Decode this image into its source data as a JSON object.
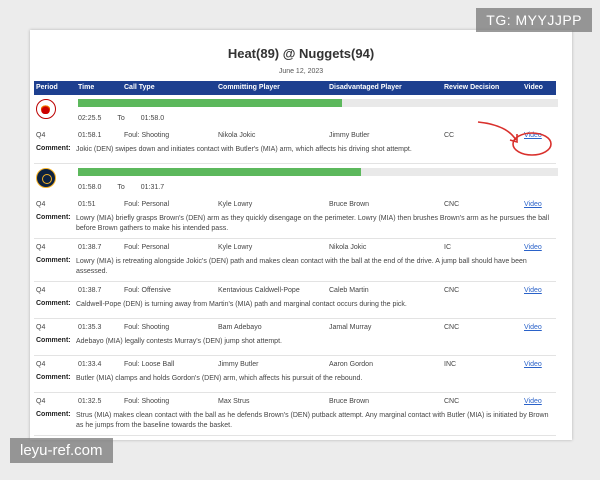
{
  "watermarks": {
    "top_right": "TG: MYYJJPP",
    "bottom_left": "leyu-ref.com"
  },
  "title": "Heat(89) @ Nuggets(94)",
  "date": "June 12, 2023",
  "columns": [
    "Period",
    "Time",
    "Call Type",
    "Committing Player",
    "Disadvantaged Player",
    "Review Decision",
    "Video"
  ],
  "to_label": "To",
  "comment_label": "Comment:",
  "blocks": [
    {
      "team": "heat",
      "team_icon": "miami-heat-logo",
      "bar_color": "#5cb85c",
      "progress": 0.55,
      "time_start": "02:25.5",
      "time_end": "01:58.0",
      "plays": [
        {
          "period": "Q4",
          "time": "01:58.1",
          "call_type": "Foul: Shooting",
          "committing": "Nikola Jokic",
          "disadvantaged": "Jimmy Butler",
          "decision": "CC",
          "video": "Video",
          "comment": "Jokic (DEN) swipes down and initiates contact with Butler's (MIA) arm, which affects his driving shot attempt."
        }
      ]
    },
    {
      "team": "nuggets",
      "team_icon": "denver-nuggets-logo",
      "bar_color": "#5cb85c",
      "progress": 0.59,
      "time_start": "01:58.0",
      "time_end": "01:31.7",
      "plays": [
        {
          "period": "Q4",
          "time": "01:51",
          "call_type": "Foul: Personal",
          "committing": "Kyle Lowry",
          "disadvantaged": "Bruce Brown",
          "decision": "CNC",
          "video": "Video",
          "comment": "Lowry (MIA) briefly grasps Brown's (DEN) arm as they quickly disengage on the perimeter. Lowry (MIA) then brushes Brown's arm as he pursues the ball before Brown gathers to make his intended pass."
        },
        {
          "period": "Q4",
          "time": "01:38.7",
          "call_type": "Foul: Personal",
          "committing": "Kyle Lowry",
          "disadvantaged": "Nikola Jokic",
          "decision": "IC",
          "video": "Video",
          "comment": "Lowry (MIA) is retreating alongside Jokic's (DEN) path and makes clean contact with the ball at the end of the drive. A jump ball should have been assessed."
        },
        {
          "period": "Q4",
          "time": "01:38.7",
          "call_type": "Foul: Offensive",
          "committing": "Kentavious Caldwell-Pope",
          "disadvantaged": "Caleb Martin",
          "decision": "CNC",
          "video": "Video",
          "comment": "Caldwell-Pope (DEN) is turning away from Martin's (MIA) path and marginal contact occurs during the pick."
        },
        {
          "period": "Q4",
          "time": "01:35.3",
          "call_type": "Foul: Shooting",
          "committing": "Bam Adebayo",
          "disadvantaged": "Jamal Murray",
          "decision": "CNC",
          "video": "Video",
          "comment": "Adebayo (MIA) legally contests Murray's (DEN) jump shot attempt."
        },
        {
          "period": "Q4",
          "time": "01:33.4",
          "call_type": "Foul: Loose Ball",
          "committing": "Jimmy Butler",
          "disadvantaged": "Aaron Gordon",
          "decision": "INC",
          "video": "Video",
          "comment": "Butler (MIA) clamps and holds Gordon's (DEN) arm, which affects his pursuit of the rebound."
        },
        {
          "period": "Q4",
          "time": "01:32.5",
          "call_type": "Foul: Shooting",
          "committing": "Max Strus",
          "disadvantaged": "Bruce Brown",
          "decision": "CNC",
          "video": "Video",
          "comment": "Strus (MIA) makes clean contact with the ball as he defends Brown's (DEN) putback attempt. Any marginal contact with Butler (MIA) is initiated by Brown as he jumps from the baseline towards the basket."
        }
      ]
    }
  ],
  "annotation_color": "#d9302c"
}
